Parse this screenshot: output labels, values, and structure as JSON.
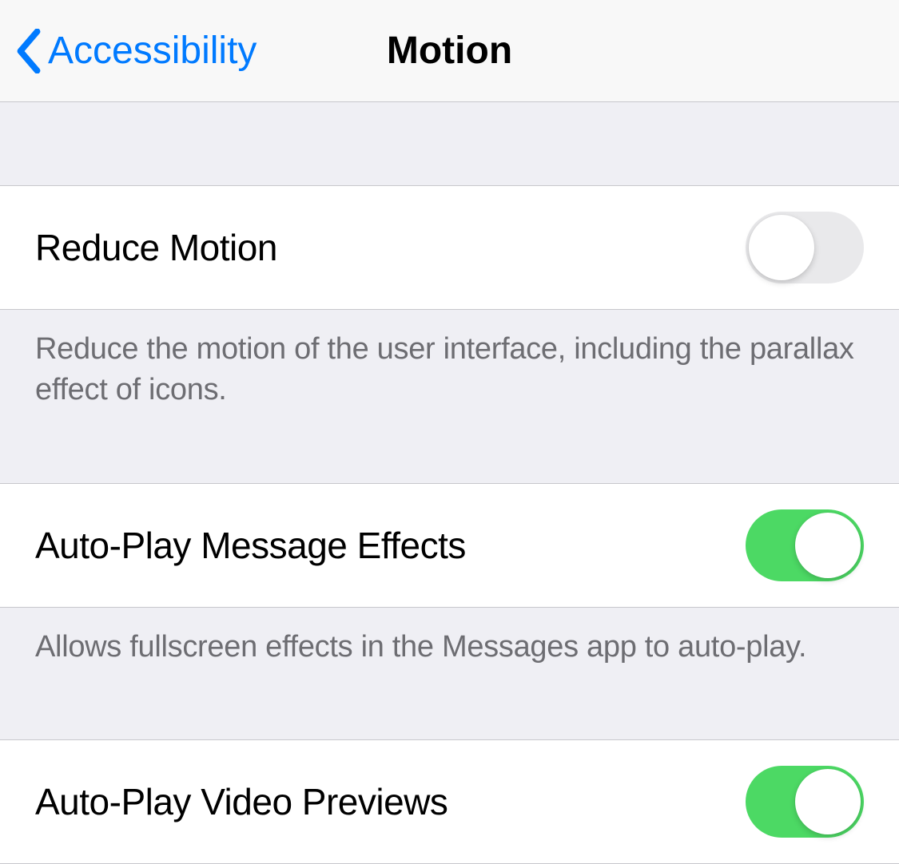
{
  "navbar": {
    "back_label": "Accessibility",
    "title": "Motion"
  },
  "sections": {
    "reduce_motion": {
      "label": "Reduce Motion",
      "footer": "Reduce the motion of the user interface, including the parallax effect of icons.",
      "enabled": false
    },
    "auto_play_message_effects": {
      "label": "Auto-Play Message Effects",
      "footer": "Allows fullscreen effects in the Messages app to auto-play.",
      "enabled": true
    },
    "auto_play_video_previews": {
      "label": "Auto-Play Video Previews",
      "enabled": true
    }
  }
}
